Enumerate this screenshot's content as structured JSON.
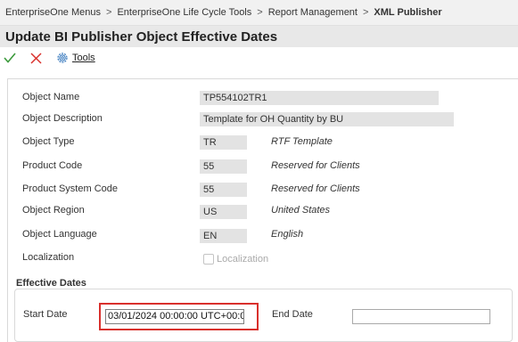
{
  "breadcrumb": {
    "items": [
      "EnterpriseOne Menus",
      "EnterpriseOne Life Cycle Tools",
      "Report Management"
    ],
    "current": "XML Publisher",
    "separator": ">"
  },
  "page": {
    "title": "Update BI Publisher Object Effective Dates"
  },
  "toolbar": {
    "tools_label": "Tools"
  },
  "form": {
    "object_name": {
      "label": "Object Name",
      "value": "TP554102TR1"
    },
    "object_description": {
      "label": "Object Description",
      "value": "Template for OH Quantity by BU"
    },
    "object_type": {
      "label": "Object Type",
      "value": "TR",
      "description": "RTF Template"
    },
    "product_code": {
      "label": "Product Code",
      "value": "55",
      "description": "Reserved for Clients"
    },
    "product_system_code": {
      "label": "Product System Code",
      "value": "55",
      "description": "Reserved for Clients"
    },
    "object_region": {
      "label": "Object Region",
      "value": "US",
      "description": "United States"
    },
    "object_language": {
      "label": "Object Language",
      "value": "EN",
      "description": "English"
    },
    "localization": {
      "label": "Localization",
      "checkbox_label": "Localization",
      "checked": false
    }
  },
  "effective_dates": {
    "title": "Effective Dates",
    "start_date": {
      "label": "Start Date",
      "value": "03/01/2024 00:00:00 UTC+00:0"
    },
    "end_date": {
      "label": "End Date",
      "value": ""
    }
  },
  "colors": {
    "confirm": "#3c9a3c",
    "cancel": "#d9302c",
    "tools": "#3a7bbf",
    "highlight": "#d9302c"
  }
}
